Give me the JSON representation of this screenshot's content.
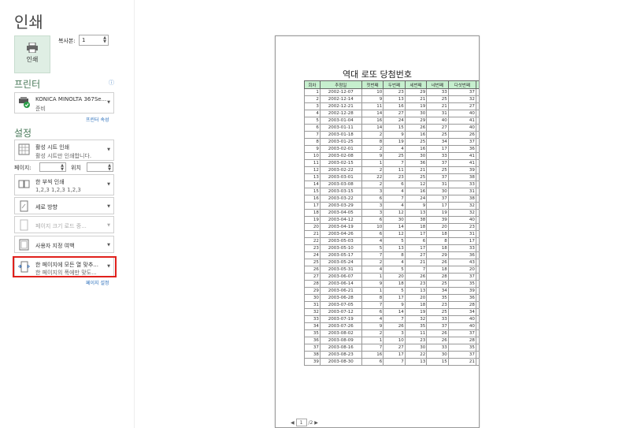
{
  "title": "인쇄",
  "print_button": {
    "label": "인쇄"
  },
  "copies": {
    "label": "복사본:",
    "value": "1"
  },
  "printer": {
    "section": "프린터",
    "name": "KONICA MINOLTA 367Se...",
    "status": "준비",
    "properties_link": "프린터 속성"
  },
  "settings": {
    "section": "설정",
    "print_what": {
      "t1": "활성 시트 인쇄",
      "t2": "활성 시트만 인쇄합니다."
    },
    "pages_label": "페이지:",
    "to_label": "위치",
    "collate": {
      "t1": "한 부씩 인쇄",
      "t2": "1,2,3    1,2,3    1,2,3"
    },
    "orientation": {
      "t1": "세로 방향"
    },
    "paper": {
      "t1": "페이지 크기 로드 중..."
    },
    "margins": {
      "t1": "사용자 지정 여백"
    },
    "scaling": {
      "t1": "한 페이지에 모든 열 맞추...",
      "t2": "한 페이지의 폭에만 맞도..."
    },
    "page_setup_link": "페이지 설정"
  },
  "preview": {
    "sheet_title": "역대 로또 당첨번호",
    "headers": [
      "회차",
      "추첨일",
      "첫번째",
      "두번째",
      "세번째",
      "네번째",
      "다섯번째",
      "여섯번째",
      "보너스",
      "1등 당첨금액"
    ],
    "rows": [
      [
        "1",
        "2002-12-07",
        "10",
        "23",
        "29",
        "33",
        "37",
        "40",
        "16",
        "0원"
      ],
      [
        "2",
        "2002-12-14",
        "9",
        "13",
        "21",
        "25",
        "32",
        "42",
        "2",
        "2,002,006,800원"
      ],
      [
        "3",
        "2002-12-21",
        "11",
        "16",
        "19",
        "21",
        "27",
        "31",
        "30",
        "2,000,000,000원"
      ],
      [
        "4",
        "2002-12-28",
        "14",
        "27",
        "30",
        "31",
        "40",
        "42",
        "2",
        "0원"
      ],
      [
        "5",
        "2003-01-04",
        "16",
        "24",
        "29",
        "40",
        "41",
        "42",
        "3",
        "0원"
      ],
      [
        "6",
        "2003-01-11",
        "14",
        "15",
        "26",
        "27",
        "40",
        "42",
        "34",
        "6,574,451,700원"
      ],
      [
        "7",
        "2003-01-18",
        "2",
        "9",
        "16",
        "25",
        "26",
        "40",
        "42",
        "0원"
      ],
      [
        "8",
        "2003-01-25",
        "8",
        "19",
        "25",
        "34",
        "37",
        "39",
        "9",
        "0원"
      ],
      [
        "9",
        "2003-02-01",
        "2",
        "4",
        "16",
        "17",
        "36",
        "39",
        "14",
        "0원"
      ],
      [
        "10",
        "2003-02-08",
        "9",
        "25",
        "30",
        "33",
        "41",
        "44",
        "6",
        "6,430,437,900원"
      ],
      [
        "11",
        "2003-02-15",
        "1",
        "7",
        "36",
        "37",
        "41",
        "42",
        "14",
        "4,780,152,300원"
      ],
      [
        "12",
        "2003-02-22",
        "2",
        "11",
        "21",
        "25",
        "39",
        "45",
        "44",
        "1,348,845,700원"
      ],
      [
        "13",
        "2003-03-01",
        "22",
        "23",
        "25",
        "37",
        "38",
        "42",
        "26",
        "0원"
      ],
      [
        "14",
        "2003-03-08",
        "2",
        "6",
        "12",
        "31",
        "33",
        "40",
        "15",
        "9,375,048,300원"
      ],
      [
        "15",
        "2003-03-15",
        "3",
        "4",
        "16",
        "30",
        "31",
        "37",
        "13",
        "17,014,245,000원"
      ],
      [
        "16",
        "2003-03-22",
        "6",
        "7",
        "24",
        "37",
        "38",
        "40",
        "33",
        "4,377,146,100원"
      ],
      [
        "17",
        "2003-03-29",
        "3",
        "4",
        "9",
        "17",
        "32",
        "37",
        "1",
        "5,349,491,200원"
      ],
      [
        "18",
        "2003-04-05",
        "3",
        "12",
        "13",
        "19",
        "32",
        "35",
        "29",
        "0원"
      ],
      [
        "19",
        "2003-04-12",
        "6",
        "30",
        "38",
        "39",
        "40",
        "43",
        "26",
        "40,722,959,400원"
      ],
      [
        "20",
        "2003-04-19",
        "10",
        "14",
        "18",
        "20",
        "23",
        "30",
        "41",
        "19,352,212,800원"
      ],
      [
        "21",
        "2003-04-26",
        "6",
        "12",
        "17",
        "18",
        "31",
        "32",
        "21",
        "797,475,400원"
      ],
      [
        "22",
        "2003-05-03",
        "4",
        "5",
        "6",
        "8",
        "17",
        "39",
        "25",
        "4,552,194,900원"
      ],
      [
        "23",
        "2003-05-10",
        "5",
        "13",
        "17",
        "18",
        "33",
        "42",
        "44",
        "4,317,947,700원"
      ],
      [
        "24",
        "2003-05-17",
        "7",
        "8",
        "27",
        "29",
        "36",
        "43",
        "6",
        "0원"
      ],
      [
        "25",
        "2003-05-24",
        "2",
        "4",
        "21",
        "26",
        "43",
        "44",
        "16",
        "24,227,745,300원"
      ],
      [
        "26",
        "2003-05-31",
        "4",
        "5",
        "7",
        "18",
        "20",
        "25",
        "31",
        "3,495,069,900원"
      ],
      [
        "27",
        "2003-06-07",
        "1",
        "20",
        "26",
        "28",
        "37",
        "43",
        "27",
        "9,543,982,500원"
      ],
      [
        "28",
        "2003-06-14",
        "9",
        "18",
        "23",
        "25",
        "35",
        "37",
        "1",
        "1,700,361,100원"
      ],
      [
        "29",
        "2003-06-21",
        "1",
        "5",
        "13",
        "34",
        "39",
        "40",
        "11",
        "3,552,594,000원"
      ],
      [
        "30",
        "2003-06-28",
        "8",
        "17",
        "20",
        "35",
        "36",
        "44",
        "4",
        "8,728,555,500원"
      ],
      [
        "31",
        "2003-07-05",
        "7",
        "9",
        "18",
        "23",
        "28",
        "35",
        "32",
        "8,106,672,900원"
      ],
      [
        "32",
        "2003-07-12",
        "6",
        "14",
        "19",
        "25",
        "34",
        "44",
        "11",
        "1,634,528,300원"
      ],
      [
        "33",
        "2003-07-19",
        "4",
        "7",
        "32",
        "33",
        "40",
        "41",
        "9",
        "14,903,517,600원"
      ],
      [
        "34",
        "2003-07-26",
        "9",
        "26",
        "35",
        "37",
        "40",
        "42",
        "2",
        "3,056,918,000원"
      ],
      [
        "35",
        "2003-08-02",
        "2",
        "3",
        "11",
        "26",
        "37",
        "43",
        "39",
        "5,054,598,200원"
      ],
      [
        "36",
        "2003-08-09",
        "1",
        "10",
        "23",
        "26",
        "28",
        "40",
        "31",
        "16,014,475,800원"
      ],
      [
        "37",
        "2003-08-16",
        "7",
        "27",
        "30",
        "33",
        "35",
        "37",
        "42",
        "4,985,999,400원"
      ],
      [
        "38",
        "2003-08-23",
        "16",
        "17",
        "22",
        "30",
        "37",
        "43",
        "36",
        "5,374,866,400원"
      ],
      [
        "39",
        "2003-08-30",
        "6",
        "7",
        "13",
        "15",
        "21",
        "43",
        "8",
        "2,623,748,800원"
      ]
    ]
  },
  "pager": {
    "current": "1",
    "total": "/2"
  },
  "colors": {
    "accent": "#4a7a5a",
    "highlight": "#e0201c",
    "header_bg": "#c6efce",
    "bonus": "#d33333"
  }
}
